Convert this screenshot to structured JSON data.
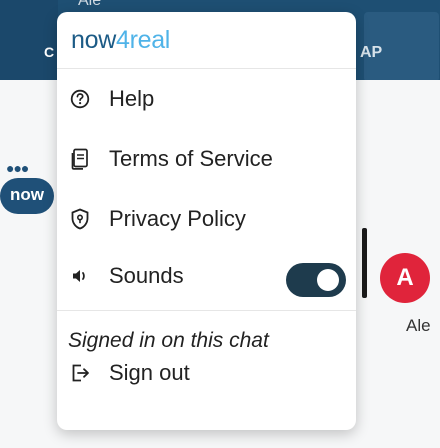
{
  "background": {
    "top_name": "Ale",
    "left_letter": "C",
    "right_text": "AP",
    "logo_text": "now",
    "badge_letter": "A",
    "right_name": "Ale"
  },
  "menu": {
    "brand_main": "now",
    "brand_digit": "4",
    "brand_rest": "real",
    "items": [
      {
        "label": "Help"
      },
      {
        "label": "Terms of Service"
      },
      {
        "label": "Privacy Policy"
      },
      {
        "label": "Sounds"
      },
      {
        "label": "Sign out"
      }
    ],
    "sounds_enabled": true,
    "signed_in_text": "Signed in on this chat"
  },
  "colors": {
    "brand": "#1c5b86",
    "brand_accent": "#4fb3e8",
    "toggle_on": "#1e3b4d",
    "badge": "#e0243b"
  }
}
